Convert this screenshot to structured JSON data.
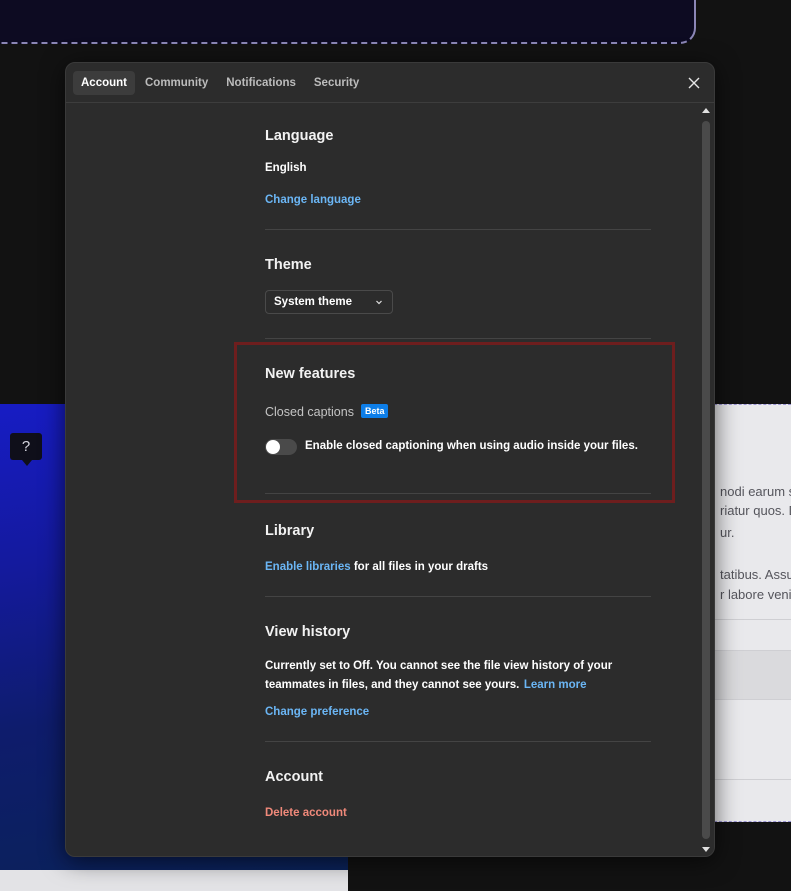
{
  "background": {
    "right_panel_lines": [
      "nodi earum si",
      "riatur quos. D",
      "ur.",
      "tatibus. Assu",
      "r labore venia"
    ],
    "help_glyph": "?"
  },
  "tabs": [
    {
      "label": "Account",
      "active": true
    },
    {
      "label": "Community",
      "active": false
    },
    {
      "label": "Notifications",
      "active": false
    },
    {
      "label": "Security",
      "active": false
    }
  ],
  "language": {
    "title": "Language",
    "value": "English",
    "change_link": "Change language"
  },
  "theme": {
    "title": "Theme",
    "selected": "System theme"
  },
  "new_features": {
    "title": "New features",
    "captions_label": "Closed captions",
    "badge": "Beta",
    "toggle_label": "Enable closed captioning when using audio inside your files.",
    "toggle_on": false
  },
  "library": {
    "title": "Library",
    "link": "Enable libraries",
    "suffix": " for all files in your drafts"
  },
  "view_history": {
    "title": "View history",
    "description": "Currently set to Off. You cannot see the file view history of your teammates in files, and they cannot see yours.",
    "learn_more": "Learn more",
    "change_link": "Change preference"
  },
  "account": {
    "title": "Account",
    "delete_link": "Delete account"
  },
  "colors": {
    "modal_bg": "#2c2c2c",
    "link": "#6bb6f5",
    "danger": "#f0897a",
    "badge": "#0d7ee8",
    "highlight": "#6e1e1e"
  }
}
